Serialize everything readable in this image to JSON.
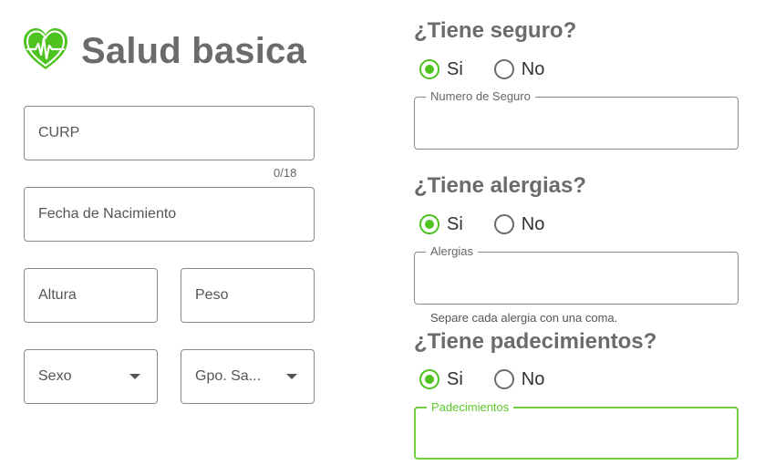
{
  "app": {
    "title": "Salud basica",
    "logo_icon": "heart-pulse-icon",
    "accent": "#4ec21f"
  },
  "form": {
    "curp": {
      "placeholder": "CURP",
      "counter": "0/18"
    },
    "birthdate": {
      "placeholder": "Fecha de Nacimiento"
    },
    "height": {
      "placeholder": "Altura"
    },
    "weight": {
      "placeholder": "Peso"
    },
    "sex": {
      "placeholder": "Sexo"
    },
    "blood_group": {
      "placeholder": "Gpo. Sa..."
    }
  },
  "insurance": {
    "question": "¿Tiene seguro?",
    "options": [
      "Si",
      "No"
    ],
    "selected": "Si",
    "field_label": "Numero de Seguro"
  },
  "allergies": {
    "question": "¿Tiene alergias?",
    "options": [
      "Si",
      "No"
    ],
    "selected": "Si",
    "field_label": "Alergias",
    "helper": "Separe cada alergia con una coma."
  },
  "conditions": {
    "question": "¿Tiene padecimientos?",
    "options": [
      "Si",
      "No"
    ],
    "selected": "Si",
    "field_label": "Padecimientos"
  }
}
